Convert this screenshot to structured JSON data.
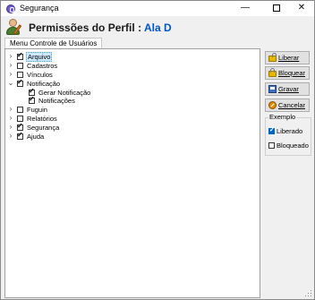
{
  "window": {
    "title": "Segurança",
    "minimize_glyph": "—",
    "close_glyph": "✕"
  },
  "header": {
    "title": "Permissões do Perfil",
    "separator": ":",
    "profile_name": "Ala D"
  },
  "tabs": [
    {
      "label": "Menu Controle de Usuários",
      "active": true
    }
  ],
  "tree": [
    {
      "label": "Arquivo",
      "checked": true,
      "expander": "›",
      "level": 0,
      "selected": true
    },
    {
      "label": "Cadastros",
      "checked": false,
      "expander": "›",
      "level": 0,
      "selected": false
    },
    {
      "label": "Vínculos",
      "checked": false,
      "expander": "›",
      "level": 0,
      "selected": false
    },
    {
      "label": "Notificação",
      "checked": true,
      "expander": "⌄",
      "level": 0,
      "selected": false
    },
    {
      "label": "Gerar Notificação",
      "checked": true,
      "expander": "",
      "level": 1,
      "selected": false
    },
    {
      "label": "Notificações",
      "checked": true,
      "expander": "",
      "level": 1,
      "selected": false
    },
    {
      "label": "Fuguin",
      "checked": false,
      "expander": "›",
      "level": 0,
      "selected": false
    },
    {
      "label": "Relatórios",
      "checked": false,
      "expander": "›",
      "level": 0,
      "selected": false
    },
    {
      "label": "Segurança",
      "checked": true,
      "expander": "›",
      "level": 0,
      "selected": false
    },
    {
      "label": "Ajuda",
      "checked": true,
      "expander": "›",
      "level": 0,
      "selected": false
    }
  ],
  "actions": {
    "liberar": {
      "label": "Liberar",
      "icon": "unlock-icon"
    },
    "bloquear": {
      "label": "Bloquear",
      "icon": "lock-icon"
    },
    "gravar": {
      "label": "Gravar",
      "icon": "save-icon"
    },
    "cancelar": {
      "label": "Cancelar",
      "icon": "cancel-icon"
    }
  },
  "example": {
    "title": "Exemplo",
    "liberado": {
      "label": "Liberado",
      "checked": true
    },
    "bloqueado": {
      "label": "Bloqueado",
      "checked": false
    }
  },
  "colors": {
    "profile_name": "#0055cc",
    "selection": "#cde8ff",
    "checked_accent": "#0067c0"
  }
}
